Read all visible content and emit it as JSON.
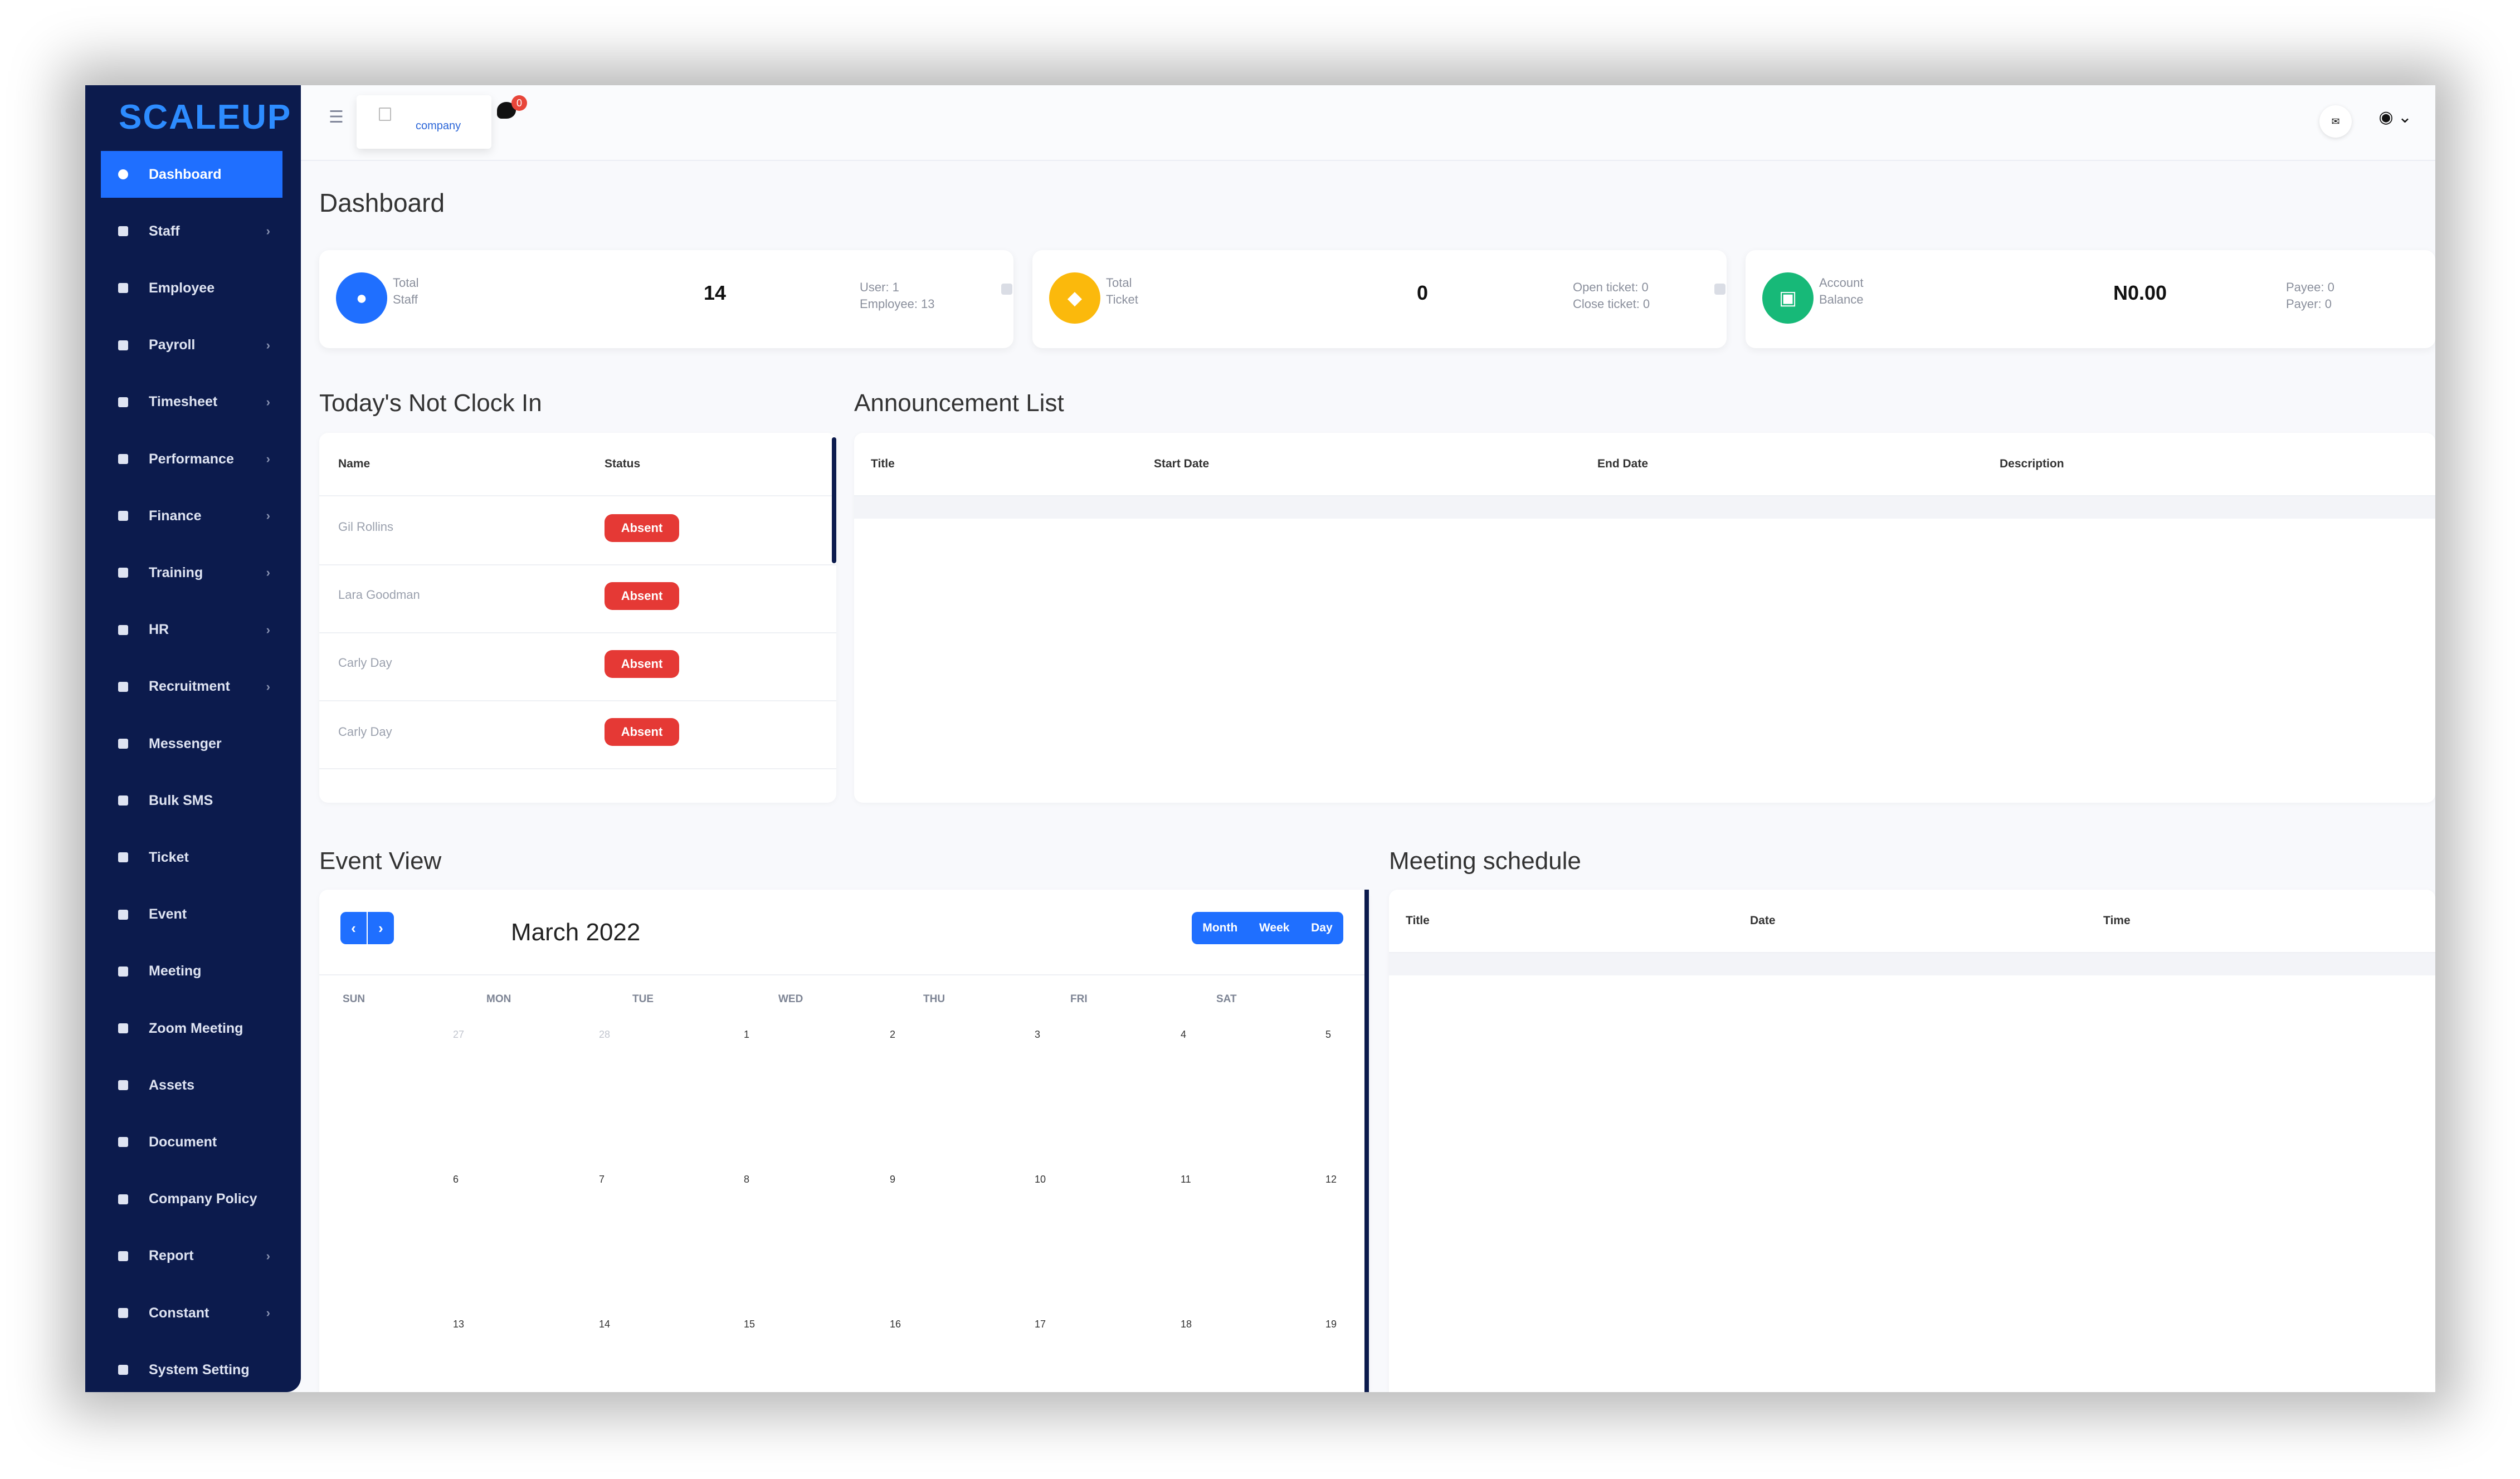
{
  "brand": {
    "logo": "SCALEUP",
    "accent": "#1f6fff",
    "sidebar_bg": "#0c1b4d"
  },
  "sidebar": {
    "items": [
      {
        "label": "Dashboard",
        "icon": "home-icon",
        "active": true,
        "chevron": false
      },
      {
        "label": "Staff",
        "icon": "staff-icon",
        "chevron": true
      },
      {
        "label": "Employee",
        "icon": "users-icon",
        "chevron": false
      },
      {
        "label": "Payroll",
        "icon": "payroll-icon",
        "chevron": true
      },
      {
        "label": "Timesheet",
        "icon": "clock-icon",
        "chevron": true
      },
      {
        "label": "Performance",
        "icon": "gauge-icon",
        "chevron": true
      },
      {
        "label": "Finance",
        "icon": "finance-icon",
        "chevron": true
      },
      {
        "label": "Training",
        "icon": "graduation-cap-icon",
        "chevron": true
      },
      {
        "label": "HR",
        "icon": "hr-icon",
        "chevron": true
      },
      {
        "label": "Recruitment",
        "icon": "recruitment-icon",
        "chevron": true
      },
      {
        "label": "Messenger",
        "icon": "chat-icon",
        "chevron": false
      },
      {
        "label": "Bulk SMS",
        "icon": "envelope-icon",
        "chevron": false
      },
      {
        "label": "Ticket",
        "icon": "ticket-icon",
        "chevron": false
      },
      {
        "label": "Event",
        "icon": "calendar-icon",
        "chevron": false
      },
      {
        "label": "Meeting",
        "icon": "meeting-icon",
        "chevron": false
      },
      {
        "label": "Zoom Meeting",
        "icon": "video-icon",
        "chevron": false
      },
      {
        "label": "Assets",
        "icon": "assets-icon",
        "chevron": false
      },
      {
        "label": "Document",
        "icon": "document-icon",
        "chevron": false
      },
      {
        "label": "Company Policy",
        "icon": "policy-icon",
        "chevron": false
      },
      {
        "label": "Report",
        "icon": "list-icon",
        "chevron": true
      },
      {
        "label": "Constant",
        "icon": "edit-icon",
        "chevron": true
      },
      {
        "label": "System Setting",
        "icon": "sliders-icon",
        "chevron": false
      }
    ]
  },
  "header": {
    "company_label": "company",
    "chat_badge": "0",
    "menu_icon": "hamburger-icon"
  },
  "page": {
    "title": "Dashboard"
  },
  "stats": [
    {
      "label1": "Total",
      "label2": "Staff",
      "value": "14",
      "sub1": "User: 1",
      "sub2": "Employee: 13",
      "color": "#1f6fff",
      "icon": "users-icon"
    },
    {
      "label1": "Total",
      "label2": "Ticket",
      "value": "0",
      "sub1": "Open ticket: 0",
      "sub2": "Close ticket: 0",
      "color": "#fbb90c",
      "icon": "tag-icon"
    },
    {
      "label1": "Account",
      "label2": "Balance",
      "value": "N0.00",
      "sub1": "Payee: 0",
      "sub2": "Payer: 0",
      "color": "#17b978",
      "icon": "money-icon"
    }
  ],
  "not_clock_in": {
    "title": "Today's Not Clock In",
    "headers": [
      "Name",
      "Status"
    ],
    "rows": [
      {
        "name": "Gil Rollins",
        "status": "Absent"
      },
      {
        "name": "Lara Goodman",
        "status": "Absent"
      },
      {
        "name": "Carly Day",
        "status": "Absent"
      },
      {
        "name": "Carly Day",
        "status": "Absent"
      }
    ]
  },
  "announcements": {
    "title": "Announcement List",
    "headers": [
      "Title",
      "Start Date",
      "End Date",
      "Description"
    ]
  },
  "event_view": {
    "title": "Event View",
    "month": "March 2022",
    "view_buttons": [
      "Month",
      "Week",
      "Day"
    ],
    "days_of_week": [
      "SUN",
      "MON",
      "TUE",
      "WED",
      "THU",
      "FRI",
      "SAT"
    ],
    "weeks": [
      [
        "27",
        "28",
        "1",
        "2",
        "3",
        "4",
        "5"
      ],
      [
        "6",
        "7",
        "8",
        "9",
        "10",
        "11",
        "12"
      ],
      [
        "13",
        "14",
        "15",
        "16",
        "17",
        "18",
        "19"
      ]
    ]
  },
  "meeting_schedule": {
    "title": "Meeting schedule",
    "headers": [
      "Title",
      "Date",
      "Time"
    ]
  }
}
